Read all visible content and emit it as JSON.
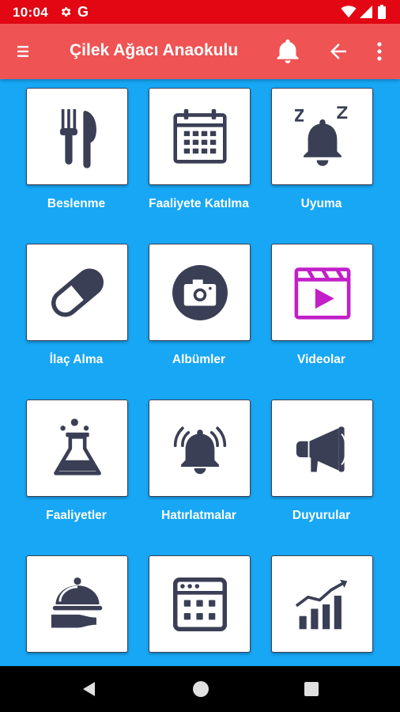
{
  "status_bar": {
    "time": "10:04",
    "g_glyph": "G",
    "icons": [
      "gear-icon",
      "wifi-icon",
      "signal-icon",
      "battery-icon"
    ]
  },
  "app_bar": {
    "title": "Çilek Ağacı Anaokulu",
    "icons": [
      "menu-icon",
      "bell-icon",
      "back-arrow-icon",
      "more-vert-icon"
    ]
  },
  "colors": {
    "status_bar": "#e30613",
    "app_bar": "#ef5353",
    "background": "#17a7f5",
    "icon_dark": "#3a3f55",
    "video_accent": "#c21fc9"
  },
  "tiles": [
    {
      "label": "Beslenme",
      "icon": "fork-knife-icon"
    },
    {
      "label": "Faaliyete Katılma",
      "icon": "calendar-icon"
    },
    {
      "label": "Uyuma",
      "icon": "sleeping-bell-icon"
    },
    {
      "label": "İlaç Alma",
      "icon": "pill-icon"
    },
    {
      "label": "Albümler",
      "icon": "camera-icon"
    },
    {
      "label": "Videolar",
      "icon": "video-play-icon"
    },
    {
      "label": "Faaliyetler",
      "icon": "flask-icon"
    },
    {
      "label": "Hatırlatmalar",
      "icon": "ringing-bell-icon"
    },
    {
      "label": "Duyurular",
      "icon": "megaphone-icon"
    },
    {
      "label": "",
      "icon": "food-cloche-icon"
    },
    {
      "label": "",
      "icon": "calendar-grid-icon"
    },
    {
      "label": "",
      "icon": "growth-chart-icon"
    }
  ],
  "nav_bar": {
    "icons": [
      "nav-back-icon",
      "nav-home-icon",
      "nav-recents-icon"
    ]
  }
}
